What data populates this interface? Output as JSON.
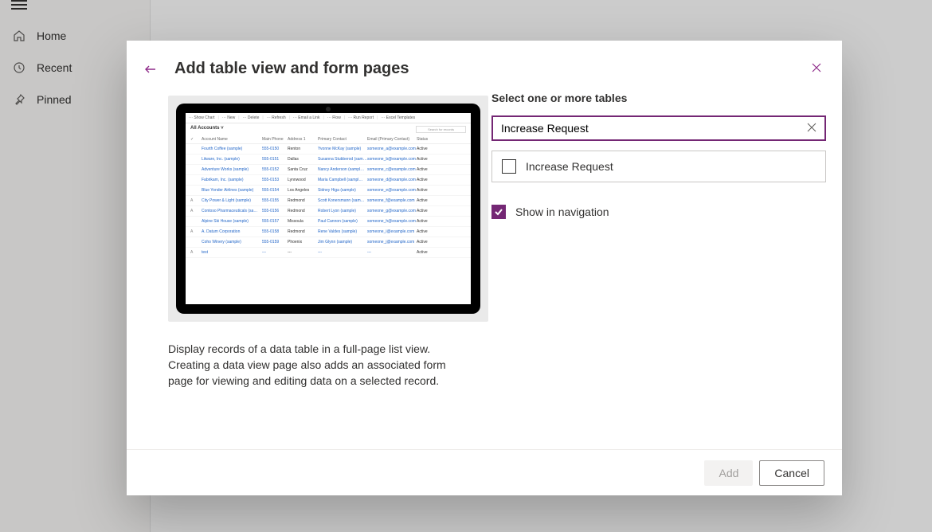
{
  "bgNav": {
    "items": [
      {
        "label": "Home"
      },
      {
        "label": "Recent"
      },
      {
        "label": "Pinned"
      }
    ]
  },
  "dialog": {
    "title": "Add table view and form pages",
    "description": "Display records of a data table in a full-page list view. Creating a data view page also adds an associated form page for viewing and editing data on a selected record.",
    "rightSectionLabel": "Select one or more tables",
    "search": {
      "value": "Increase Request"
    },
    "tableOption": "Increase Request",
    "showInNavLabel": "Show in navigation",
    "addLabel": "Add",
    "cancelLabel": "Cancel"
  },
  "preview": {
    "toolbar": [
      "Show Chart",
      "New",
      "Delete",
      "Refresh",
      "Email a Link",
      "Flow",
      "Run Report",
      "Excel Templates"
    ],
    "viewTitle": "All Accounts",
    "searchPlaceholder": "Search for records",
    "columns": [
      "Account Name",
      "Main Phone",
      "Address 1",
      "Primary Contact",
      "Email (Primary Contact)",
      "Status"
    ],
    "rows": [
      {
        "name": "Fourth Coffee (sample)",
        "phone": "555-0150",
        "addr": "Renton",
        "contact": "Yvonne McKay (sample)",
        "email": "someone_a@example.com",
        "status": "Active"
      },
      {
        "name": "Litware, Inc. (sample)",
        "phone": "555-0151",
        "addr": "Dallas",
        "contact": "Susanna Stubberod (sam…",
        "email": "someone_b@example.com",
        "status": "Active"
      },
      {
        "name": "Adventure Works (sample)",
        "phone": "555-0152",
        "addr": "Santa Cruz",
        "contact": "Nancy Anderson (sampl…",
        "email": "someone_c@example.com",
        "status": "Active"
      },
      {
        "name": "Fabrikam, Inc. (sample)",
        "phone": "555-0153",
        "addr": "Lynnwood",
        "contact": "Maria Campbell (sampl…",
        "email": "someone_d@example.com",
        "status": "Active"
      },
      {
        "name": "Blue Yonder Airlines (sample)",
        "phone": "555-0154",
        "addr": "Los Angeles",
        "contact": "Sidney Higa (sample)",
        "email": "someone_e@example.com",
        "status": "Active"
      },
      {
        "name": "City Power & Light (sample)",
        "phone": "555-0155",
        "addr": "Redmond",
        "contact": "Scott Konersmann (sam…",
        "email": "someone_f@example.com",
        "status": "Active",
        "chk": "A"
      },
      {
        "name": "Contoso Pharmaceuticals (sa…",
        "phone": "555-0156",
        "addr": "Redmond",
        "contact": "Robert Lyon (sample)",
        "email": "someone_g@example.com",
        "status": "Active",
        "chk": "A"
      },
      {
        "name": "Alpine Ski House (sample)",
        "phone": "555-0157",
        "addr": "Missoula",
        "contact": "Paul Cannon (sample)",
        "email": "someone_h@example.com",
        "status": "Active"
      },
      {
        "name": "A. Datum Corporation",
        "phone": "555-0158",
        "addr": "Redmond",
        "contact": "Rene Valdes (sample)",
        "email": "someone_i@example.com",
        "status": "Active",
        "chk": "A"
      },
      {
        "name": "Coho Winery (sample)",
        "phone": "555-0159",
        "addr": "Phoenix",
        "contact": "Jim Glynn (sample)",
        "email": "someone_j@example.com",
        "status": "Active"
      },
      {
        "name": "test",
        "phone": "---",
        "addr": "---",
        "contact": "---",
        "email": "---",
        "status": "Active",
        "chk": "A"
      }
    ]
  }
}
